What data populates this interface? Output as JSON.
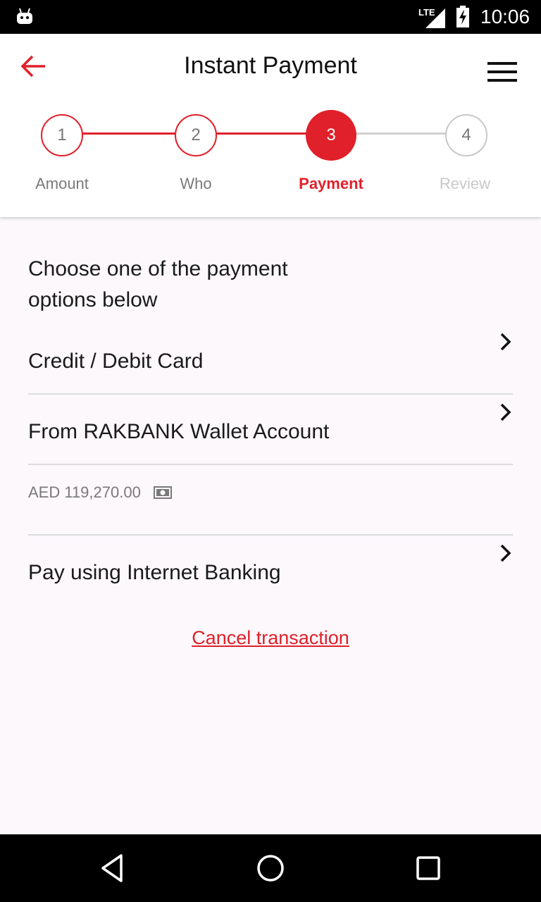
{
  "status_bar": {
    "network": "LTE",
    "time": "10:06",
    "icons": [
      "android-icon",
      "signal-icon",
      "battery-charging-icon"
    ]
  },
  "header": {
    "title": "Instant Payment",
    "back_icon": "back-arrow-icon",
    "menu_icon": "hamburger-menu-icon"
  },
  "stepper": {
    "steps": [
      {
        "number": "1",
        "label": "Amount",
        "state": "done"
      },
      {
        "number": "2",
        "label": "Who",
        "state": "done"
      },
      {
        "number": "3",
        "label": "Payment",
        "state": "active"
      },
      {
        "number": "4",
        "label": "Review",
        "state": "upcoming"
      }
    ]
  },
  "content": {
    "intro": "Choose one of the payment options below",
    "options": [
      {
        "label": "Credit / Debit Card"
      },
      {
        "label": "From RAKBANK Wallet Account"
      },
      {
        "label": "Pay using Internet Banking"
      }
    ],
    "wallet_balance": "AED 119,270.00",
    "cancel_label": "Cancel transaction"
  },
  "colors": {
    "accent": "#e0202a",
    "inactive": "#c8c8c8",
    "background": "#fcf8fc"
  },
  "nav_bar": {
    "buttons": [
      "back-triangle-icon",
      "home-circle-icon",
      "recents-square-icon"
    ]
  }
}
